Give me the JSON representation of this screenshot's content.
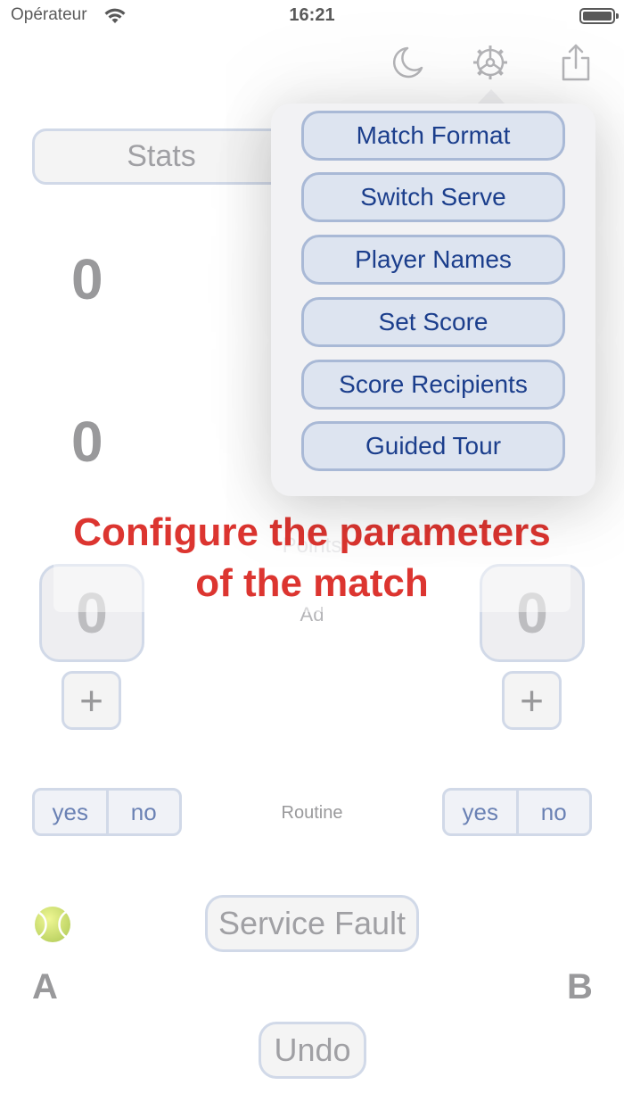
{
  "status_bar": {
    "carrier": "Opérateur",
    "time": "16:21"
  },
  "toolbar": {
    "dark_mode_icon": "moon-icon",
    "settings_icon": "gear-icon",
    "share_icon": "share-icon"
  },
  "stats_button": "Stats",
  "games": {
    "top": "0",
    "bottom": "0"
  },
  "points": {
    "label": "Points",
    "mode": "Ad",
    "player_a": "0",
    "player_b": "0",
    "plus_label": "+"
  },
  "routine": {
    "label": "Routine",
    "yes": "yes",
    "no": "no"
  },
  "serve_indicator_icon": "tennis-ball-icon",
  "service_fault_label": "Service Fault",
  "players": {
    "a": "A",
    "b": "B"
  },
  "undo_label": "Undo",
  "settings_menu": {
    "items": [
      {
        "label": "Match Format"
      },
      {
        "label": "Switch Serve"
      },
      {
        "label": "Player Names"
      },
      {
        "label": "Set Score"
      },
      {
        "label": "Score Recipients"
      },
      {
        "label": "Guided Tour"
      }
    ]
  },
  "coach_mark": {
    "line1": "Configure the parameters",
    "line2": "of the match",
    "color": "#dc3530"
  },
  "colors": {
    "accent_text": "#1b3e8c",
    "button_border": "#b8c5dc"
  }
}
